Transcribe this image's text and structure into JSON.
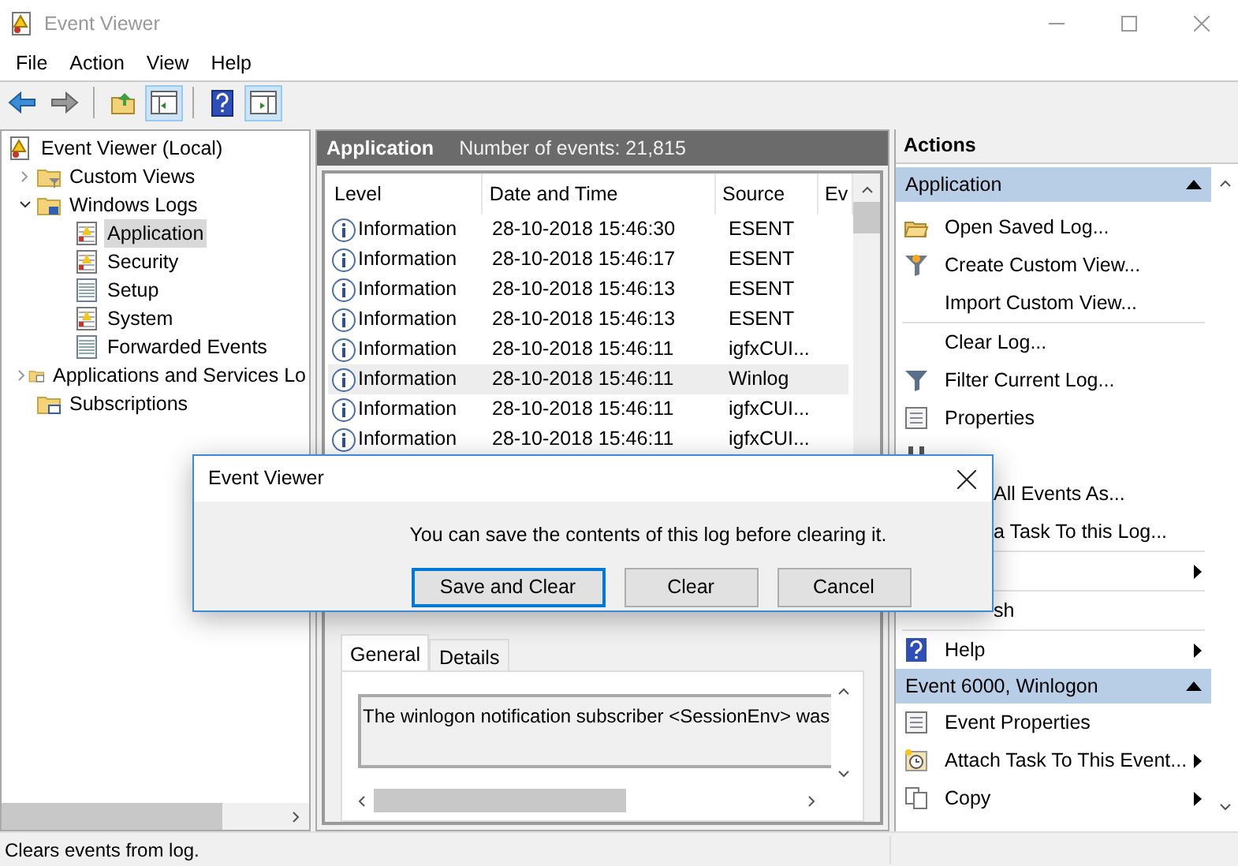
{
  "window": {
    "title": "Event Viewer"
  },
  "menu": [
    "File",
    "Action",
    "View",
    "Help"
  ],
  "toolbar": [
    {
      "kind": "back",
      "pressed": false
    },
    {
      "kind": "forward",
      "pressed": false
    },
    {
      "kind": "sep"
    },
    {
      "kind": "up",
      "pressed": false
    },
    {
      "kind": "tree",
      "pressed": true
    },
    {
      "kind": "sep"
    },
    {
      "kind": "help",
      "pressed": false
    },
    {
      "kind": "pane",
      "pressed": true
    }
  ],
  "tree": [
    {
      "label": "Event Viewer (Local)",
      "kind": "viewer",
      "selected": false,
      "children": [
        {
          "label": "Custom Views",
          "kind": "filterfolder",
          "expanded": false,
          "selected": false
        },
        {
          "label": "Windows Logs",
          "kind": "logfolder",
          "expanded": true,
          "selected": false,
          "children": [
            {
              "label": "Application",
              "kind": "alertlog",
              "selected": true
            },
            {
              "label": "Security",
              "kind": "alertlog",
              "selected": false
            },
            {
              "label": "Setup",
              "kind": "log",
              "selected": false
            },
            {
              "label": "System",
              "kind": "alertlog",
              "selected": false
            },
            {
              "label": "Forwarded Events",
              "kind": "log",
              "selected": false
            }
          ]
        },
        {
          "label": "Applications and Services Lo",
          "kind": "appfolder",
          "expanded": false,
          "selected": false
        },
        {
          "label": "Subscriptions",
          "kind": "subfolder",
          "selected": false
        }
      ]
    }
  ],
  "center": {
    "title": "Application",
    "count": "Number of events: 21,815",
    "columns": [
      "Level",
      "Date and Time",
      "Source",
      "Ev"
    ],
    "rows": [
      {
        "level": "Information",
        "date": "28-10-2018 15:46:30",
        "source": "ESENT",
        "selected": false
      },
      {
        "level": "Information",
        "date": "28-10-2018 15:46:17",
        "source": "ESENT",
        "selected": false
      },
      {
        "level": "Information",
        "date": "28-10-2018 15:46:13",
        "source": "ESENT",
        "selected": false
      },
      {
        "level": "Information",
        "date": "28-10-2018 15:46:13",
        "source": "ESENT",
        "selected": false
      },
      {
        "level": "Information",
        "date": "28-10-2018 15:46:11",
        "source": "igfxCUI...",
        "selected": false
      },
      {
        "level": "Information",
        "date": "28-10-2018 15:46:11",
        "source": "Winlog",
        "selected": true
      },
      {
        "level": "Information",
        "date": "28-10-2018 15:46:11",
        "source": "igfxCUI...",
        "selected": false
      },
      {
        "level": "Information",
        "date": "28-10-2018 15:46:11",
        "source": "igfxCUI...",
        "selected": false
      }
    ],
    "tabs": [
      {
        "label": "General",
        "selected": true
      },
      {
        "label": "Details",
        "selected": false
      }
    ],
    "detail_text": "The winlogon notification subscriber <SessionEnv> was"
  },
  "actions": {
    "title": "Actions",
    "sections": [
      {
        "title": "Application",
        "items": [
          {
            "kind": "item",
            "label": "Open Saved Log...",
            "submenu": false
          },
          {
            "kind": "item",
            "label": "Create Custom View...",
            "submenu": false
          },
          {
            "kind": "item",
            "label": "Import Custom View...",
            "submenu": false
          },
          {
            "kind": "divider"
          },
          {
            "kind": "item",
            "label": "Clear Log...",
            "submenu": false
          },
          {
            "kind": "item",
            "label": "Filter Current Log...",
            "submenu": false
          },
          {
            "kind": "item",
            "label": "Properties",
            "submenu": false
          },
          {
            "kind": "item",
            "submenu": false
          },
          {
            "kind": "covered",
            "label": "All Events As...",
            "submenu": false
          },
          {
            "kind": "covered",
            "label": "a Task To this Log...",
            "submenu": false
          },
          {
            "kind": "divider"
          },
          {
            "kind": "covered",
            "submenu": true
          },
          {
            "kind": "divider"
          },
          {
            "kind": "covered",
            "label": "sh",
            "submenu": false
          },
          {
            "kind": "divider"
          },
          {
            "kind": "item",
            "label": "Help",
            "submenu": true
          }
        ]
      },
      {
        "title": "Event 6000, Winlogon",
        "items": [
          {
            "kind": "item",
            "label": "Event Properties",
            "submenu": false
          },
          {
            "kind": "item",
            "label": "Attach Task To This Event...",
            "submenu": true
          },
          {
            "kind": "item",
            "label": "Copy",
            "submenu": true
          }
        ]
      }
    ]
  },
  "dialog": {
    "title": "Event Viewer",
    "message": "You can save the contents of this log before clearing it.",
    "buttons": [
      {
        "label": "Save and Clear",
        "default": true
      },
      {
        "label": "Clear",
        "default": false
      },
      {
        "label": "Cancel",
        "default": false
      }
    ]
  },
  "status_bar": "Clears events from log."
}
